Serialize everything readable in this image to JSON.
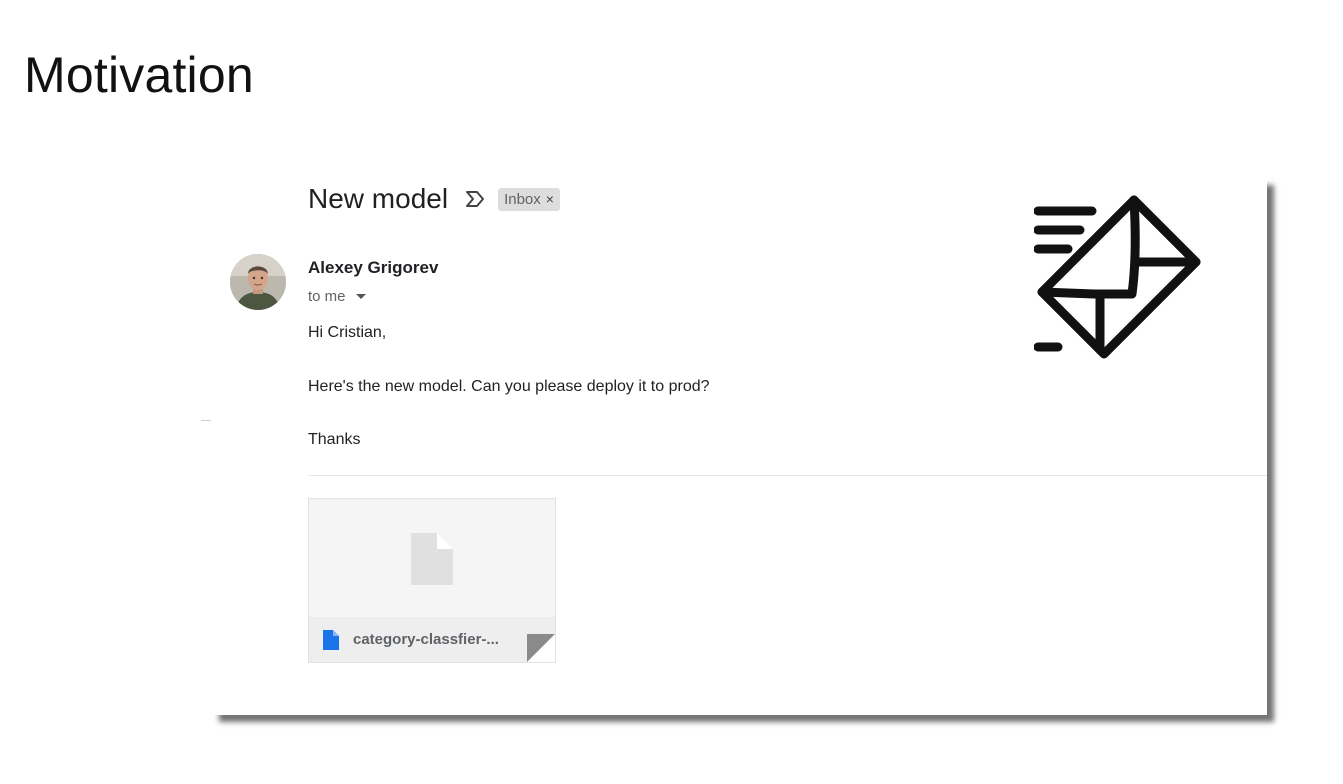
{
  "slide": {
    "title": "Motivation"
  },
  "email": {
    "subject": "New model",
    "label_chip": "Inbox",
    "label_chip_close": "×",
    "sender_name": "Alexey Grigorev",
    "recipient": "to me",
    "body": {
      "greeting": "Hi Cristian,",
      "message": "Here's the new model. Can you please deploy it to prod?",
      "signoff": "Thanks"
    },
    "attachment": {
      "filename": "category-classfier-..."
    }
  },
  "icons": {
    "label": "label-outline-icon",
    "avatar": "avatar",
    "dropdown": "chevron-down-icon",
    "file": "file-icon",
    "envelope": "fast-mail-icon"
  },
  "colors": {
    "file_icon_blue": "#1a73e8",
    "chip_bg": "#dddddd"
  }
}
